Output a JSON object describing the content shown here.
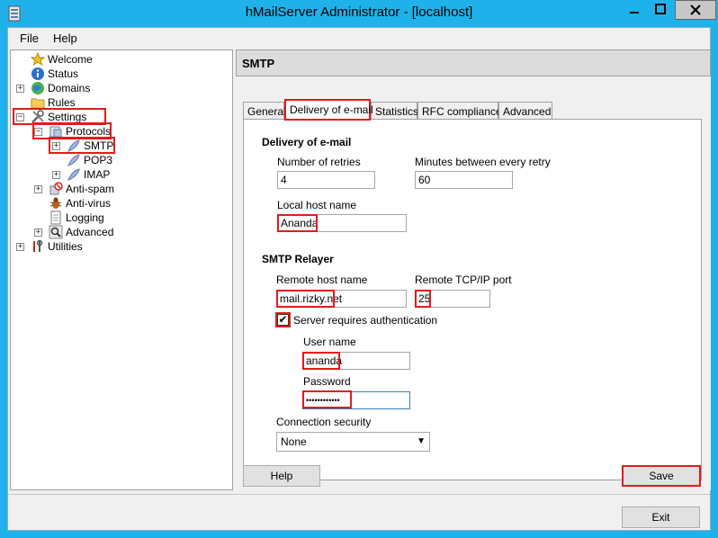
{
  "window": {
    "title": "hMailServer Administrator - [localhost]"
  },
  "menu": [
    "File",
    "Help"
  ],
  "tree": {
    "welcome": "Welcome",
    "status": "Status",
    "domains": "Domains",
    "rules": "Rules",
    "settings": "Settings",
    "protocols": "Protocols",
    "smtp": "SMTP",
    "pop3": "POP3",
    "imap": "IMAP",
    "antispam": "Anti-spam",
    "antivirus": "Anti-virus",
    "logging": "Logging",
    "advanced": "Advanced",
    "utilities": "Utilities"
  },
  "panel": {
    "header": "SMTP",
    "tabs": [
      "General",
      "Delivery of e-mail",
      "Statistics",
      "RFC compliance",
      "Advanced"
    ],
    "delivery": {
      "section": "Delivery of e-mail",
      "retries_label": "Number of retries",
      "retries_value": "4",
      "minutes_label": "Minutes between every retry",
      "minutes_value": "60",
      "localhost_label": "Local host name",
      "localhost_value": "Ananda"
    },
    "relayer": {
      "section": "SMTP Relayer",
      "remote_host_label": "Remote host name",
      "remote_host_value": "mail.rizky.net",
      "port_label": "Remote TCP/IP port",
      "port_value": "25",
      "auth_label": "Server requires authentication",
      "auth_checked": "✔",
      "username_label": "User name",
      "username_value": "ananda",
      "password_label": "Password",
      "password_value": "••••••••••••",
      "security_label": "Connection security",
      "security_value": "None"
    },
    "help_button": "Help",
    "save_button": "Save"
  },
  "exit_button": "Exit",
  "colors": {
    "titlebar": "#1fb2ea",
    "highlight": "#e21b1b"
  }
}
